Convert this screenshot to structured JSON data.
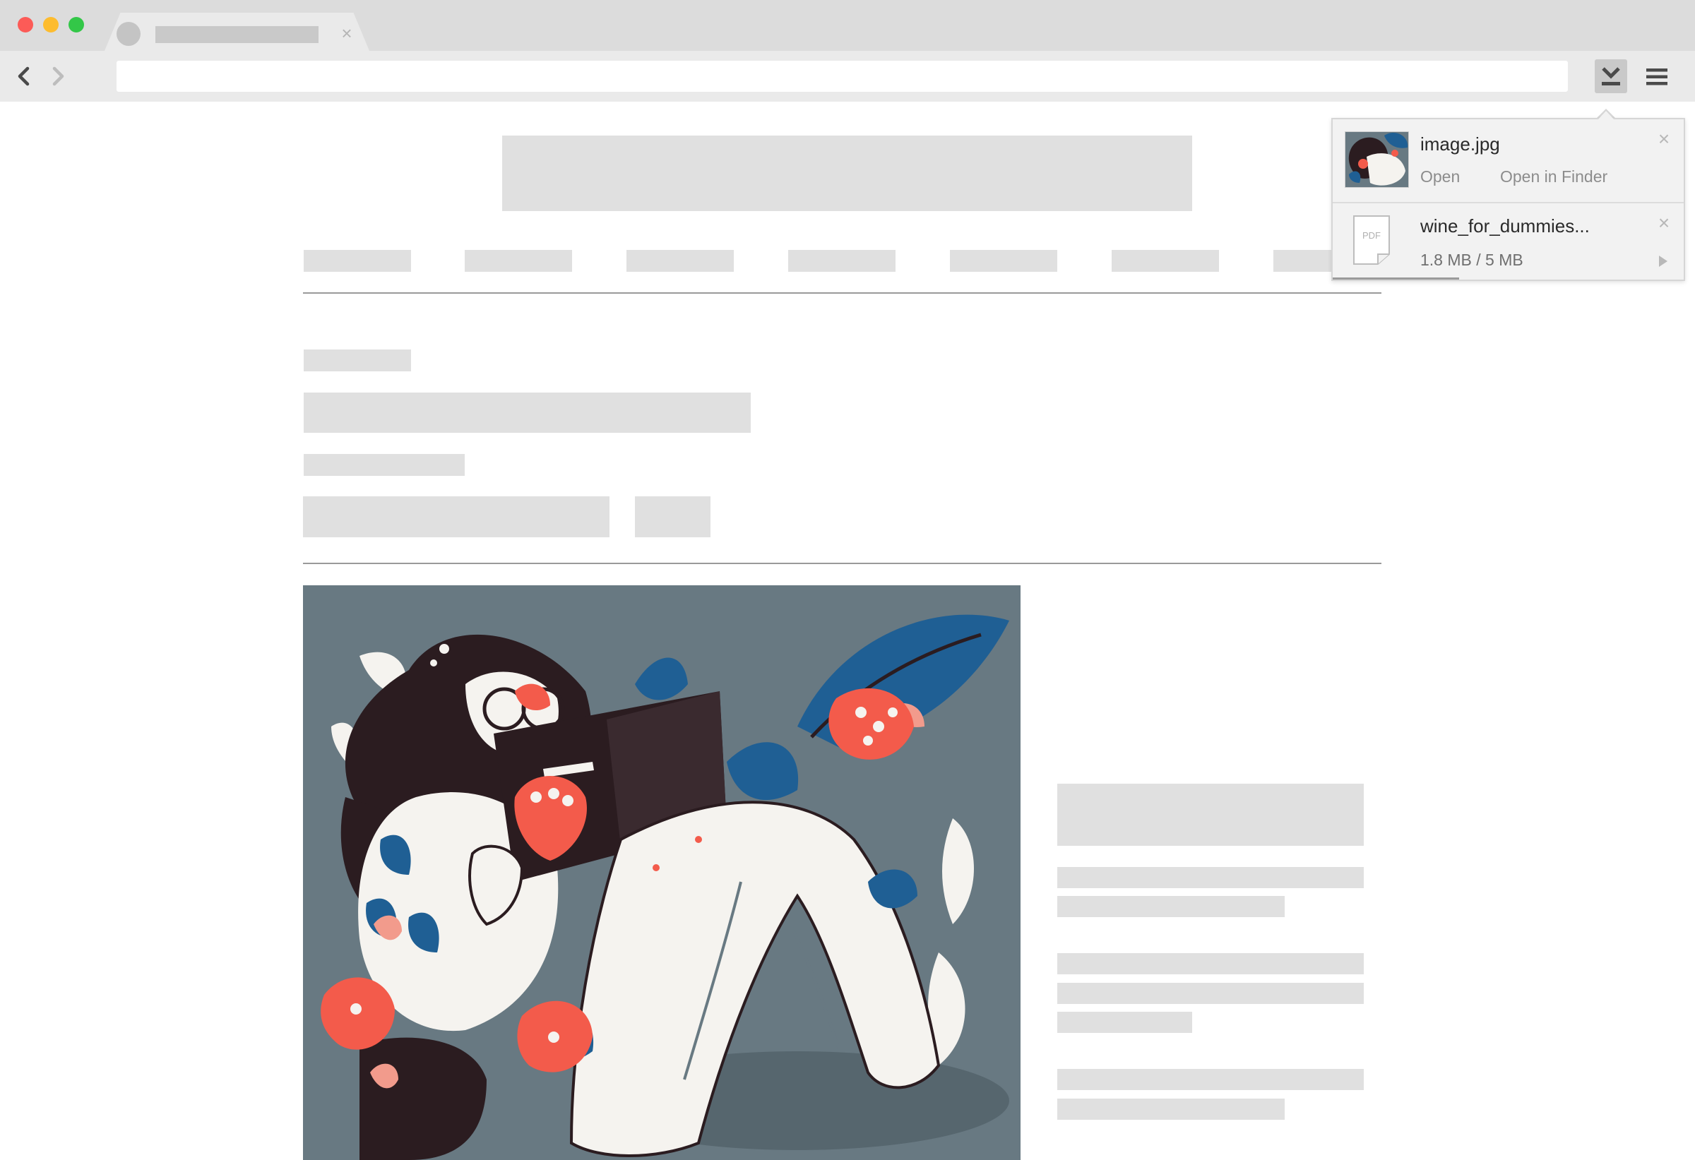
{
  "browser": {
    "traffic_lights": {
      "close": "#fc5b57",
      "minimize": "#fdbc2e",
      "maximize": "#33c748"
    },
    "icons": {
      "back": "chevron-left-icon",
      "forward": "chevron-right-icon",
      "tab_close": "close-icon",
      "downloads": "download-icon",
      "menu": "hamburger-menu-icon"
    },
    "tab_close_glyph": "×",
    "address_value": ""
  },
  "downloads": {
    "items": [
      {
        "filename": "image.jpg",
        "status": "complete",
        "actions": {
          "open": "Open",
          "open_in_finder": "Open in Finder"
        },
        "remove_glyph": "×"
      },
      {
        "filename": "wine_for_dummies...",
        "status": "in-progress",
        "file_type_label": "PDF",
        "progress_text": "1.8 MB / 5 MB",
        "progress_fraction": 0.36,
        "remove_glyph": "×"
      }
    ]
  },
  "illustration": {
    "background": "#687982",
    "palette": [
      "#1f5f94",
      "#f35b4b",
      "#f5f3ef",
      "#2b1c20",
      "#f29b8c"
    ]
  }
}
